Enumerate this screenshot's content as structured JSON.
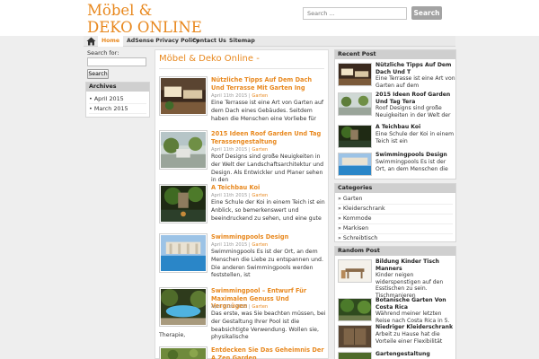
{
  "header": {
    "title_line1": "Möbel &",
    "title_line2": "Deko Online",
    "search_placeholder": "Search ...",
    "search_button": "Search"
  },
  "nav": {
    "items": [
      {
        "label": "Home",
        "active": true
      },
      {
        "label": "AdSense Privacy Policy",
        "active": false
      },
      {
        "label": "Contact Us",
        "active": false
      },
      {
        "label": "Sitemap",
        "active": false
      }
    ]
  },
  "left": {
    "search_label": "Search for:",
    "search_button": "Search",
    "archives_title": "Archives",
    "archives": [
      "April 2015",
      "March 2015"
    ]
  },
  "main": {
    "heading": "Möbel & Deko Online -",
    "posts": [
      {
        "title": "Nützliche Tipps Auf Dem Dach Und Terrasse Mit Garten Ing",
        "date": "April 11th 2015",
        "sep": " | ",
        "category": "Garten",
        "excerpt": "Eine Terrasse ist eine Art von Garten auf dem Dach eines Gebäudes. Seitdem haben die Menschen eine Vorliebe für",
        "tail": ""
      },
      {
        "title": "2015 Ideen Roof Garden Und Tag Terassengestaltung",
        "date": "April 11th 2015",
        "sep": " | ",
        "category": "Garten",
        "excerpt": "Roof Designs sind große Neuigkeiten in der Welt der Landschaftsarchitektur und Design. Als Entwickler und Planer sehen in den",
        "tail": ""
      },
      {
        "title": "A Teichbau Koi",
        "date": "April 11th 2015",
        "sep": " | ",
        "category": "Garten",
        "excerpt": "Eine Schule der Koi in einem Teich ist ein Anblick, so bemerkenswert und beeindruckend zu sehen, und eine gute",
        "tail": ""
      },
      {
        "title": "Swimmingpools Design",
        "date": "April 11th 2015",
        "sep": " | ",
        "category": "Garten",
        "excerpt": "Swimmingpools Es ist der Ort, an dem Menschen die Liebe zu entspannen und. Die anderen Swimmingpools werden feststellen, ist",
        "tail": ""
      },
      {
        "title": "Swimmingpool – Entwurf Für Maximalen Genuss Und Vergnügen",
        "date": "April 11th 2015",
        "sep": " | ",
        "category": "Garten",
        "excerpt": "Das erste, was Sie beachten müssen, bei der Gestaltung Ihrer Pool ist die beabsichtigte Verwendung. Wollen sie, physikalische",
        "tail": "Therapie,"
      },
      {
        "title": "Entdecken Sie Das Geheimnis Der A Zen Garden",
        "date": "",
        "sep": "",
        "category": "",
        "excerpt": "",
        "tail": ""
      }
    ]
  },
  "right": {
    "recent_title": "Recent Post",
    "recent": [
      {
        "title": "Nützliche Tipps Auf Dem Dach Und T",
        "text": "Eine Terrasse ist eine Art von Garten auf dem"
      },
      {
        "title": "2015 Ideen Roof Garden Und Tag Tera",
        "text": "Roof Designs sind große Neuigkeiten in der Welt der"
      },
      {
        "title": "A Teichbau Koi",
        "text": "Eine Schule der Koi in einem Teich ist ein"
      },
      {
        "title": "Swimmingpools Design",
        "text": "Swimmingpools Es ist der Ort, an dem Menschen die"
      }
    ],
    "categories_title": "Categories",
    "categories": [
      "» Garten",
      "» Kleiderschrank",
      "» Kommode",
      "» Markisen",
      "» Schreibtisch"
    ],
    "random_title": "Random Post",
    "random": [
      {
        "title": "Bildung Kinder Tisch Manners",
        "text": "Kinder neigen widerspenstigen auf den Esstischen zu sein. Tischmanieren"
      },
      {
        "title": "Botanische Garten Von Costa Rica",
        "text": "Während meiner letzten Reise nach Costa Rica in 5."
      },
      {
        "title": "Niedriger Kleiderschrank",
        "text": "Arbeit zu Hause hat die Vorteile einer Flexibilität"
      },
      {
        "title": "Gartengestaltung",
        "text": ""
      }
    ]
  },
  "colors": {
    "accent": "#e8881e",
    "nav_bg": "#e9e9e9",
    "page_bg": "#eeeeee"
  },
  "icons": {
    "nav_home": "home-icon"
  }
}
